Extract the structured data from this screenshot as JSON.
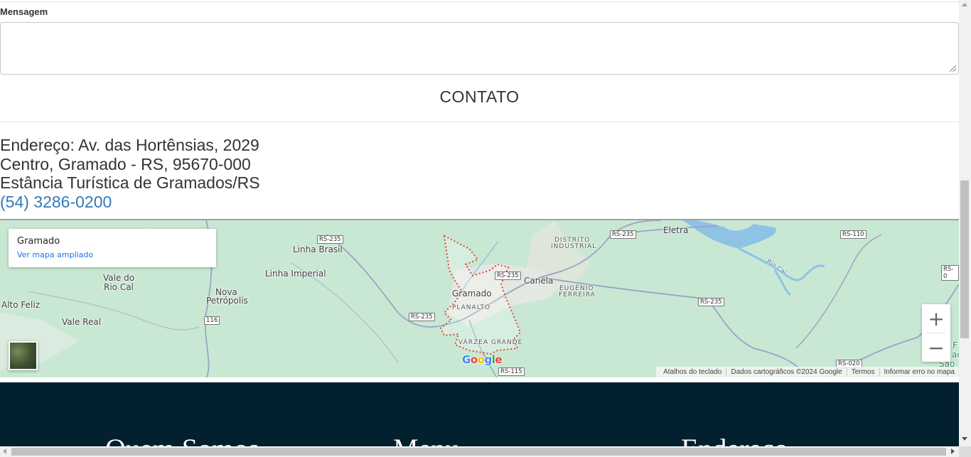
{
  "form": {
    "message_label": "Mensagem",
    "message_value": "",
    "message_placeholder": ""
  },
  "contact": {
    "title": "CONTATO",
    "address_line1": "Endereço: Av. das Hortênsias, 2029",
    "address_line2": "Centro, Gramado - RS, 95670-000",
    "address_line3": "Estância Turística de Gramados/RS",
    "phone": "(54) 3286-0200"
  },
  "map": {
    "place_name": "Gramado",
    "enlarged_link": "Ver mapa ampliado",
    "zoom_in": "+",
    "zoom_out": "−",
    "footer": {
      "shortcuts": "Atalhos do teclado",
      "map_data": "Dados cartográficos ©2024 Google",
      "terms": "Termos",
      "report": "Informar erro no mapa"
    },
    "labels": {
      "linha_brasil": "Linha Brasil",
      "linha_imperial": "Linha Imperial",
      "vale_do": "Vale do",
      "rio_cal": "Rio Cal",
      "alto_feliz": "Alto Feliz",
      "vale_real": "Vale Real",
      "nova": "Nova",
      "petropolis": "Petrópolis",
      "gramado": "Gramado",
      "planalto": "PLANALTO",
      "varzea_grande": "VÁRZEA GRANDE",
      "canela": "Canela",
      "distrito": "DISTRITO",
      "industrial": "INDUSTRIAL",
      "eugenio": "EUGÊNIO",
      "ferreira": "FERREIRA",
      "eletra": "Eletra",
      "rio_cai": "Rio Caí",
      "sao": "São",
      "f_partial": "F",
      "ac_partial": "ac"
    },
    "roads": {
      "rs235_a": "RS-235",
      "rs235_b": "RS-235",
      "rs235_c": "RS-235",
      "rs235_d": "RS-235",
      "rs235_e": "RS-235",
      "rs110": "RS-110",
      "rs115": "RS-115",
      "rs020": "RS-020",
      "br116": "116",
      "rs0": "RS-0"
    },
    "logo_letters": [
      "G",
      "o",
      "o",
      "g",
      "l",
      "e"
    ],
    "logo_colors": [
      "#4285f4",
      "#ea4335",
      "#fbbc05",
      "#4285f4",
      "#34a853",
      "#ea4335"
    ],
    "colors": {
      "land": "#c9e8d4",
      "urban": "#e8eae6",
      "water": "#8ec3e6",
      "road": "#a8b0c8",
      "boundary": "#e0463a"
    }
  },
  "footer": {
    "col1": "Quem Somos",
    "col2": "Menu",
    "col3": "Endereço"
  },
  "colors": {
    "link": "#337ab7",
    "footer_bg": "#03202f"
  }
}
